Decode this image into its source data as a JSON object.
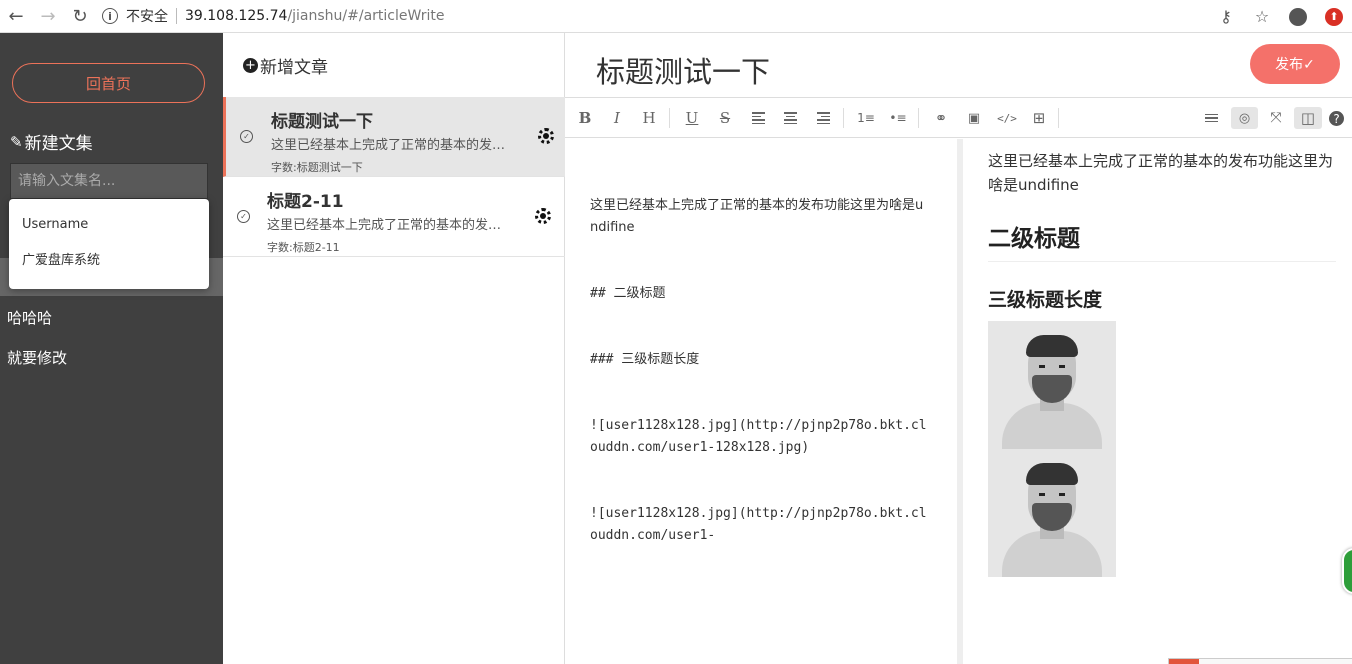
{
  "browser": {
    "insecure_label": "不安全",
    "url_host": "39.108.125.74",
    "url_path": "/jianshu/#/articleWrite"
  },
  "sidebar": {
    "home_button": "回首页",
    "new_set_label": "新建文集",
    "set_input_placeholder": "请输入文集名...",
    "autocomplete": [
      "Username",
      "广爱盘库系统"
    ],
    "sets": [
      "哈哈哈",
      "就要修改"
    ]
  },
  "article_list": {
    "new_article_label": "新增文章",
    "articles": [
      {
        "title": "标题测试一下",
        "excerpt": "这里已经基本上完成了正常的基本的发布功能这里为啥是undifine",
        "count": "字数:标题测试一下"
      },
      {
        "title": "标题2-11",
        "excerpt": "这里已经基本上完成了正常的基本的发布功能这里为啥是undifine",
        "count": "字数:标题2-11"
      }
    ]
  },
  "editor": {
    "title": "标题测试一下",
    "publish_label": "发布✓",
    "markdown_lines": [
      "这里已经基本上完成了正常的基本的发布功能这里为啥是undifine",
      "## 二级标题",
      "### 三级标题长度",
      "![user1128x128.jpg](http://pjnp2p78o.bkt.clouddn.com/user1-128x128.jpg)",
      "![user1128x128.jpg](http://pjnp2p78o.bkt.clouddn.com/user1-"
    ],
    "preview": {
      "paragraph": "这里已经基本上完成了正常的基本的发布功能这里为啥是undifine",
      "h2": "二级标题",
      "h3": "三级标题长度"
    }
  },
  "toolbar_icons": [
    "bold-icon",
    "italic-icon",
    "header-icon",
    "underline-icon",
    "strikethrough-icon",
    "align-left-icon",
    "align-center-icon",
    "align-right-icon",
    "ordered-list-icon",
    "unordered-list-icon",
    "link-icon",
    "image-icon",
    "code-icon",
    "table-icon",
    "menu-icon",
    "preview-toggle-icon",
    "fullscreen-icon",
    "split-view-icon",
    "help-icon"
  ],
  "colors": {
    "accent": "#ec7259",
    "publish": "#f4716a",
    "sidebar_bg": "#404040"
  }
}
